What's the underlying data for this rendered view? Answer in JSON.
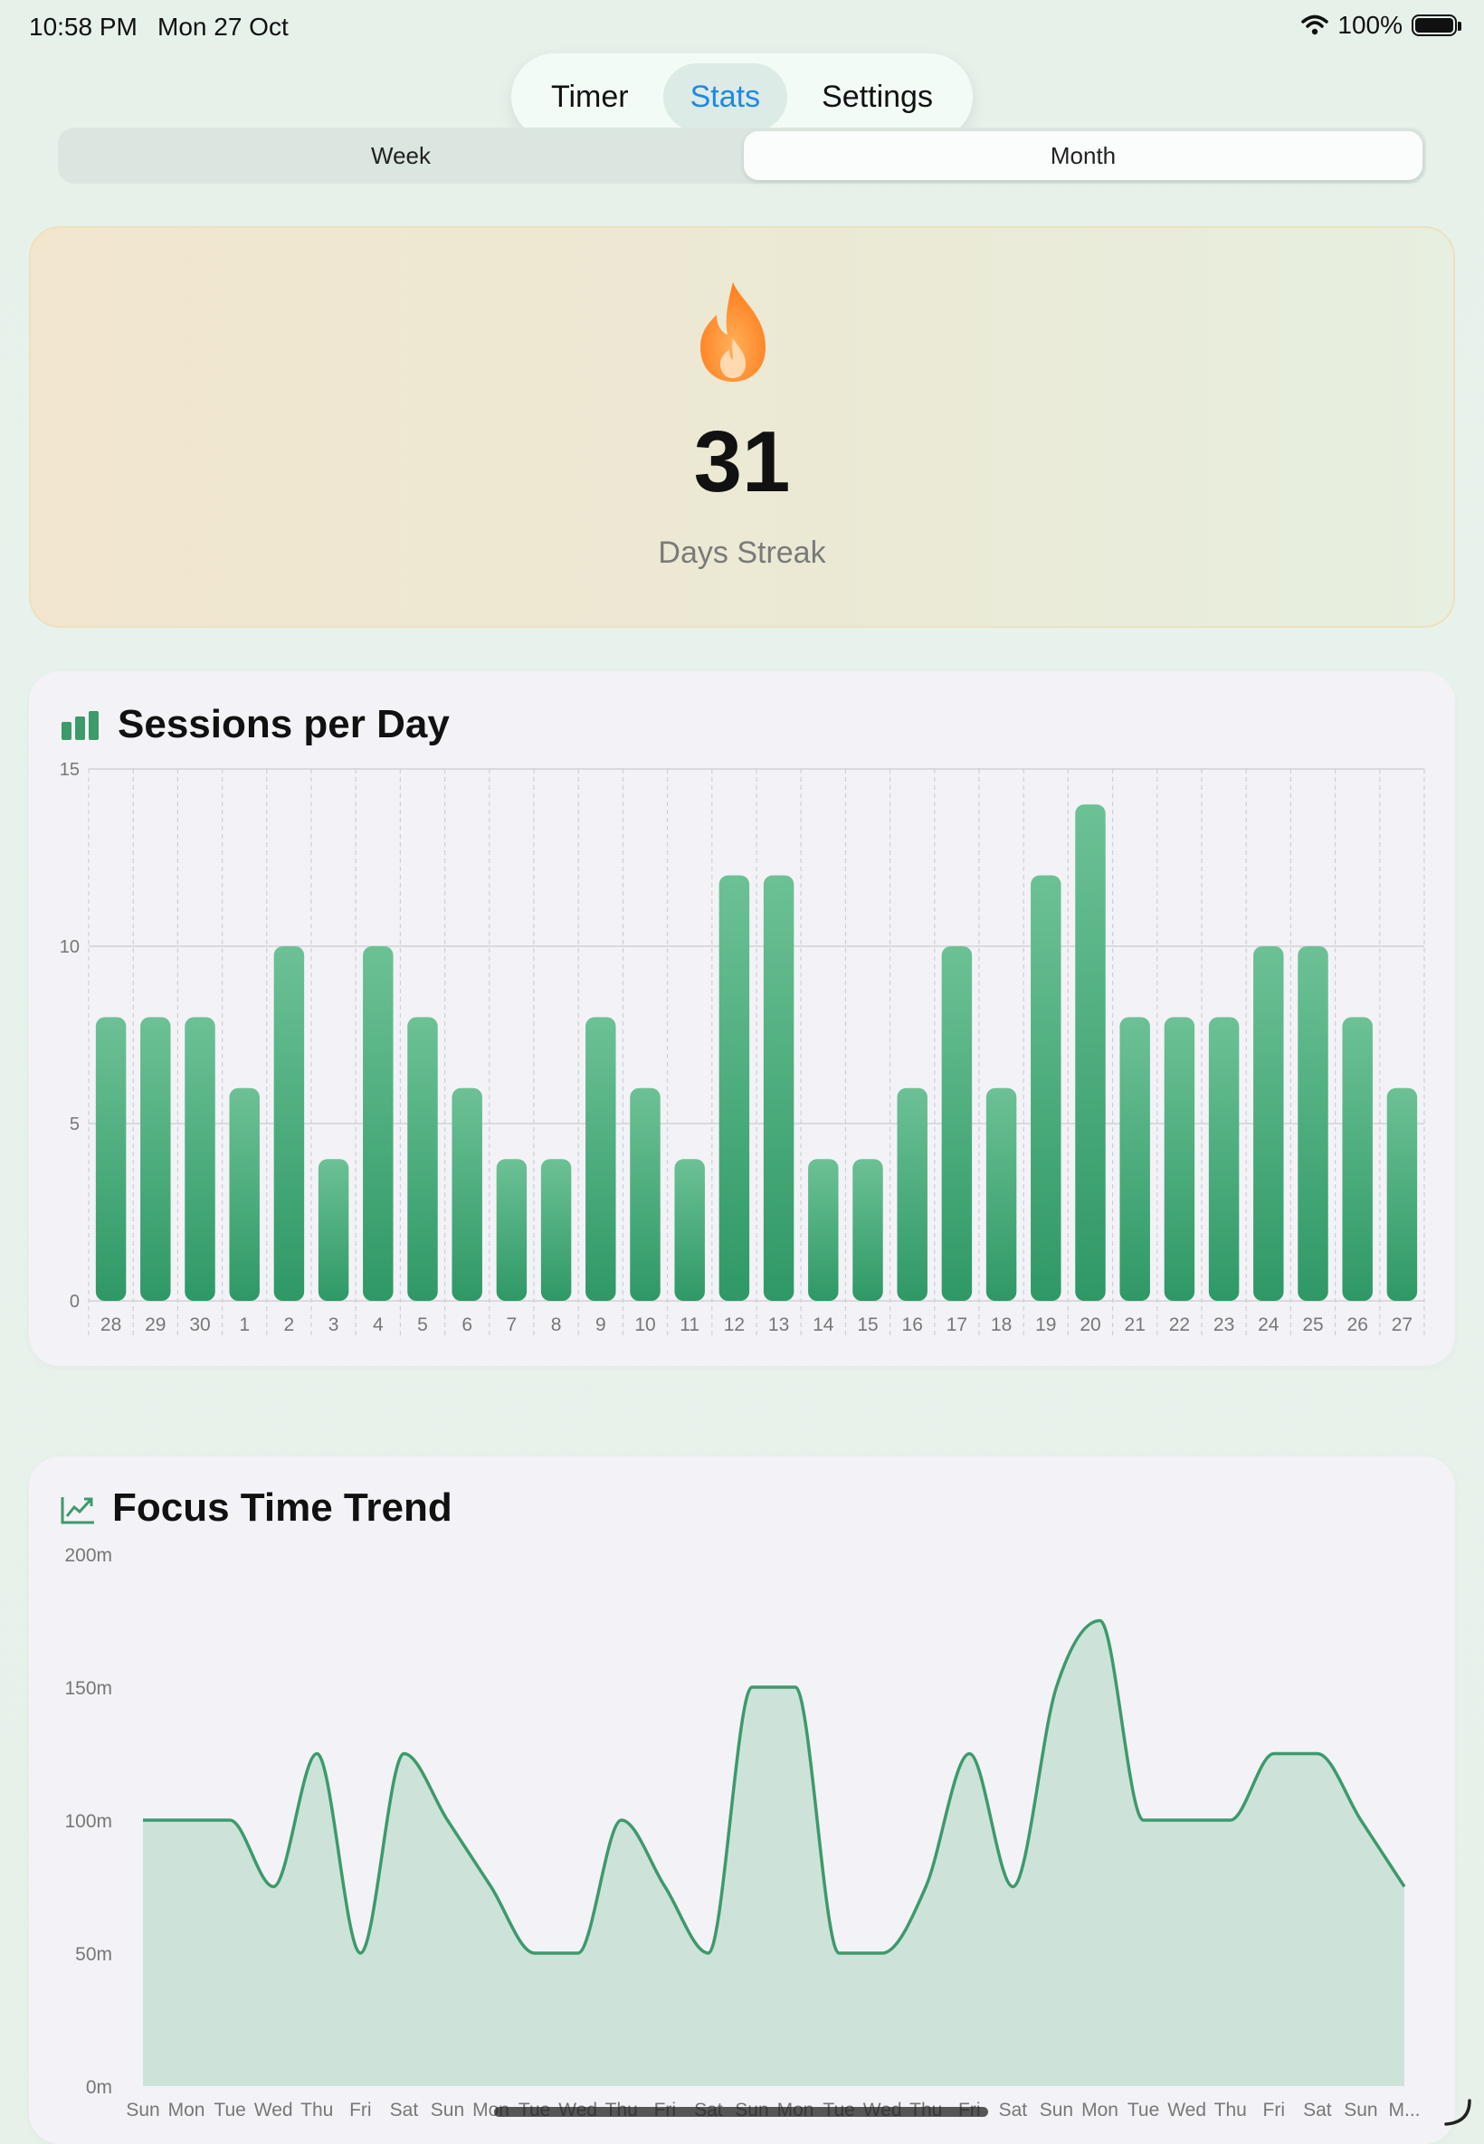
{
  "status_bar": {
    "time": "10:58 PM",
    "date": "Mon 27 Oct",
    "wifi_icon": "wifi-icon",
    "battery": "100%"
  },
  "tabs": [
    {
      "label": "Timer",
      "active": false
    },
    {
      "label": "Stats",
      "active": true
    },
    {
      "label": "Settings",
      "active": false
    }
  ],
  "period": {
    "options": [
      "Week",
      "Month"
    ],
    "selected": "Month"
  },
  "streak": {
    "icon": "flame-icon",
    "value": "31",
    "label": "Days Streak"
  },
  "colors": {
    "accent_blue": "#1e88e5",
    "bar_green_top": "#6cc195",
    "bar_green_bottom": "#2f9866",
    "line_green": "#3d9a6b",
    "area_fill": "#cde3da",
    "flame_orange": "#ff8a2a"
  },
  "chart_data": [
    {
      "type": "bar",
      "title": "Sessions per Day",
      "icon": "bar-chart-icon",
      "categories": [
        "28",
        "29",
        "30",
        "1",
        "2",
        "3",
        "4",
        "5",
        "6",
        "7",
        "8",
        "9",
        "10",
        "11",
        "12",
        "13",
        "14",
        "15",
        "16",
        "17",
        "18",
        "19",
        "20",
        "21",
        "22",
        "23",
        "24",
        "25",
        "26",
        "27"
      ],
      "values": [
        8,
        8,
        8,
        6,
        10,
        4,
        10,
        8,
        6,
        4,
        4,
        8,
        6,
        4,
        12,
        12,
        4,
        4,
        6,
        10,
        6,
        12,
        14,
        8,
        8,
        8,
        10,
        10,
        8,
        6
      ],
      "yticks": [
        "0",
        "5",
        "10",
        "15"
      ],
      "ylim": [
        0,
        15
      ],
      "grid": true
    },
    {
      "type": "area",
      "title": "Focus Time Trend",
      "icon": "trend-chart-icon",
      "categories": [
        "Sun",
        "Mon",
        "Tue",
        "Wed",
        "Thu",
        "Fri",
        "Sat",
        "Sun",
        "Mon",
        "Tue",
        "Wed",
        "Thu",
        "Fri",
        "Sat",
        "Sun",
        "Mon",
        "Tue",
        "Wed",
        "Thu",
        "Fri",
        "Sat",
        "Sun",
        "Mon",
        "Tue",
        "Wed",
        "Thu",
        "Fri",
        "Sat",
        "Sun",
        "M..."
      ],
      "values": [
        100,
        100,
        100,
        75,
        125,
        50,
        125,
        100,
        75,
        50,
        50,
        100,
        75,
        50,
        150,
        150,
        50,
        50,
        75,
        125,
        75,
        150,
        175,
        100,
        100,
        100,
        125,
        125,
        100,
        75
      ],
      "yticks": [
        "0m",
        "50m",
        "100m",
        "150m",
        "200m"
      ],
      "ylim": [
        0,
        200
      ],
      "grid": false
    }
  ]
}
